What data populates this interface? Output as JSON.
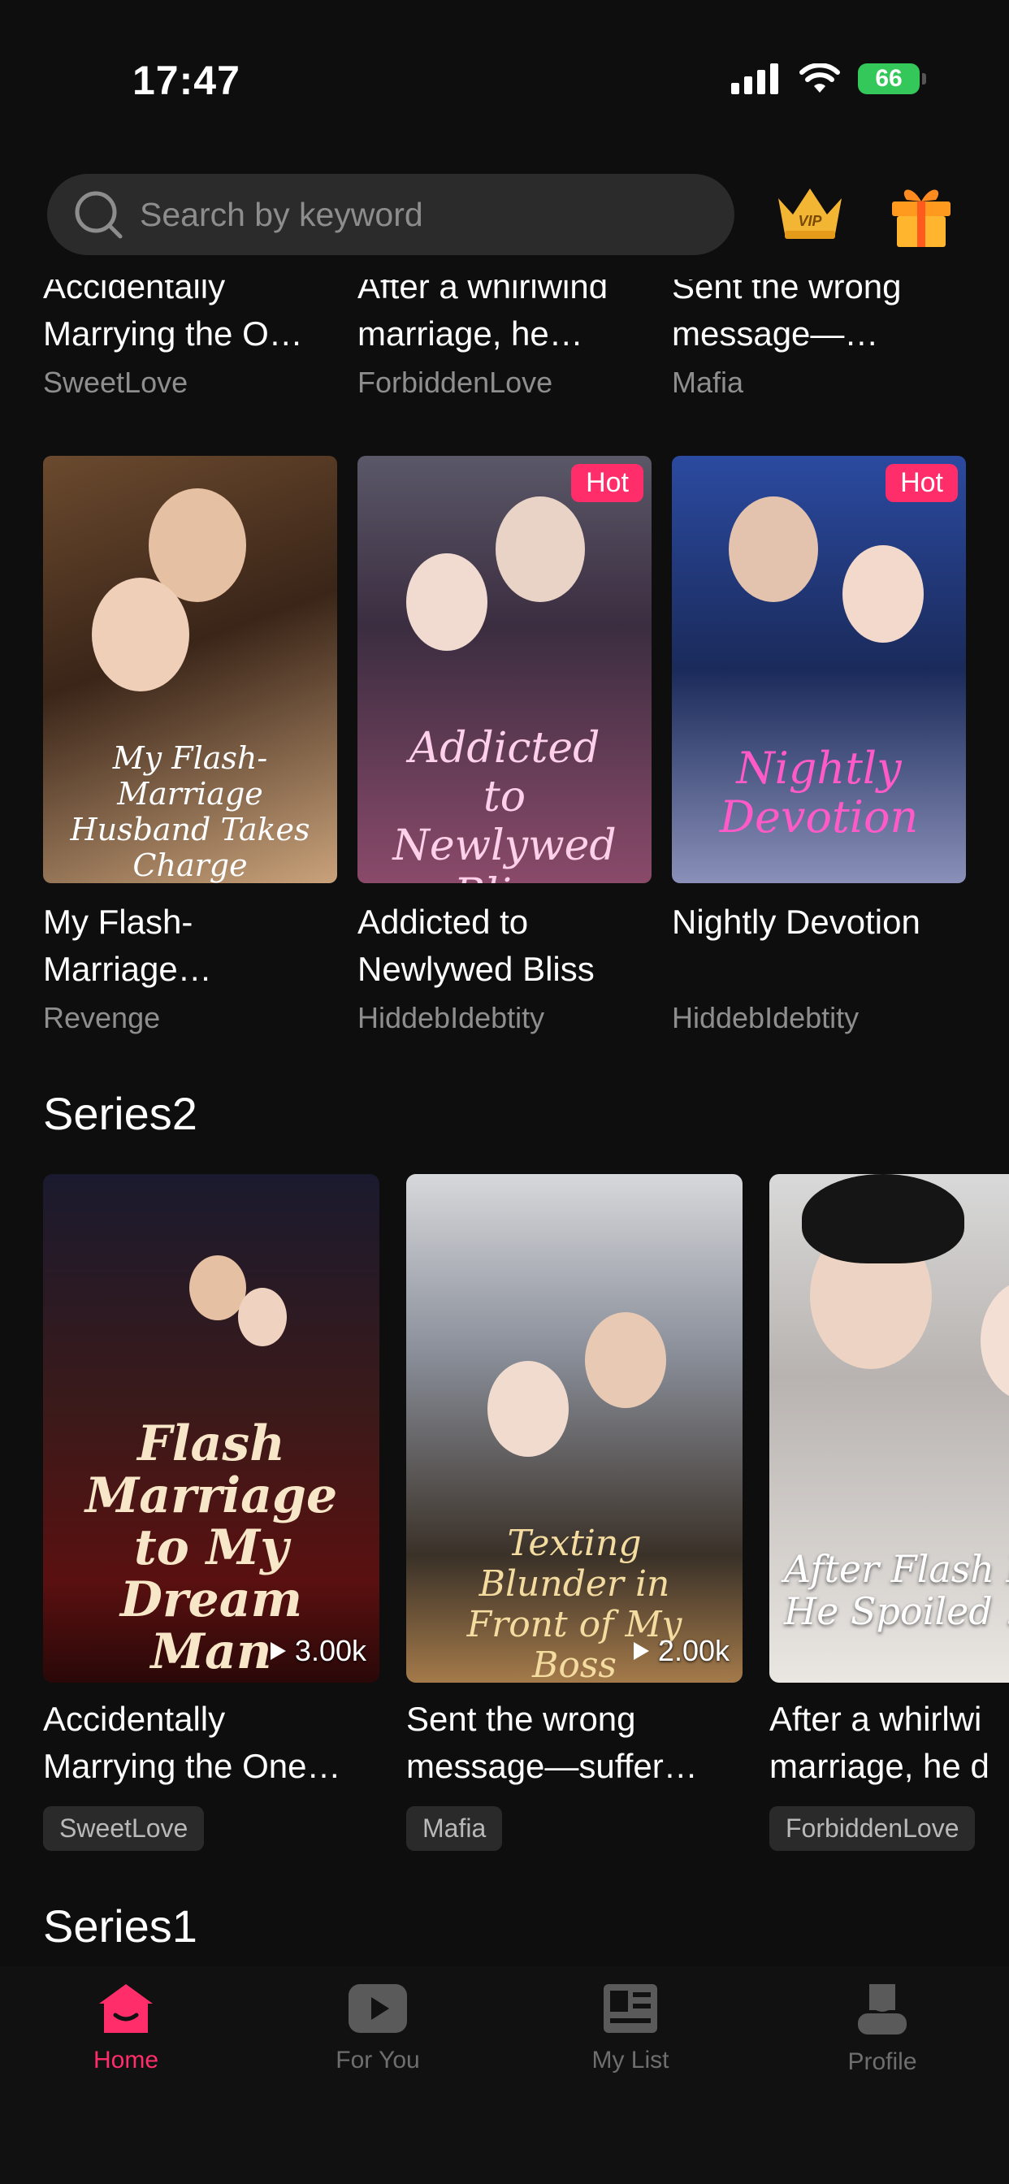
{
  "status_bar": {
    "time": "17:47",
    "battery": "66"
  },
  "search": {
    "placeholder": "Search by keyword",
    "icon": "search-icon"
  },
  "header_icons": {
    "vip": "vip-crown-icon",
    "gift": "gift-icon"
  },
  "top_grid": {
    "row1": [
      {
        "title": "Accidentally Marrying the O…",
        "tag": "SweetLove"
      },
      {
        "title": "After a whirlwind marriage, he…",
        "tag": "ForbiddenLove"
      },
      {
        "title": "Sent the wrong message—…",
        "tag": "Mafia"
      }
    ],
    "row2": [
      {
        "poster_text": "My Flash-Marriage Husband Takes Charge",
        "title": "My Flash-Marriage…",
        "tag": "Revenge",
        "badge": ""
      },
      {
        "poster_text": "Addicted to Newlywed Bliss",
        "title": "Addicted to Newlywed Bliss",
        "tag": "HiddebIdebtity",
        "badge": "Hot"
      },
      {
        "poster_text": "Nightly Devotion",
        "title": "Nightly Devotion",
        "tag": "HiddebIdebtity",
        "badge": "Hot"
      }
    ]
  },
  "series2": {
    "title": "Series2",
    "cards": [
      {
        "poster_text": "Flash Marriage to My Dream Man",
        "plays": "3.00k",
        "title_line1": "Accidentally",
        "title_line2": "Marrying the One…",
        "tag": "SweetLove"
      },
      {
        "poster_text": "Texting Blunder in Front of My Boss",
        "plays": "2.00k",
        "title_line1": "Sent the wrong",
        "title_line2": "message—suffer…",
        "tag": "Mafia"
      },
      {
        "poster_text": "After Flash Ma… He Spoiled …",
        "plays": "",
        "title_line1": "After a whirlwi",
        "title_line2": "marriage, he d",
        "tag": "ForbiddenLove"
      }
    ]
  },
  "series1": {
    "title": "Series1"
  },
  "nav": {
    "active_color": "#ff2e6a",
    "items": [
      {
        "label": "Home",
        "icon": "home-icon"
      },
      {
        "label": "For You",
        "icon": "play-icon"
      },
      {
        "label": "My List",
        "icon": "list-icon"
      },
      {
        "label": "Profile",
        "icon": "profile-icon"
      }
    ]
  }
}
